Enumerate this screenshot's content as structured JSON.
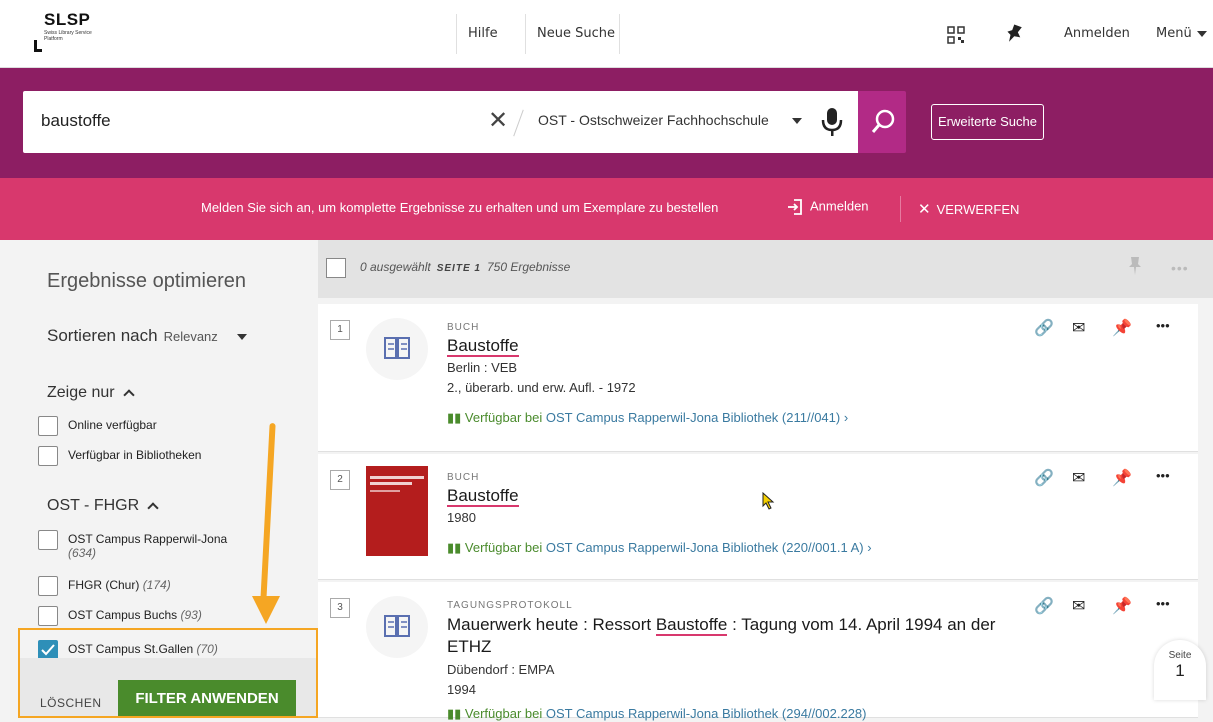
{
  "header": {
    "logo_title": "SLSP",
    "logo_subtitle": "Swiss Library Service Platform",
    "nav": [
      "Hilfe",
      "Neue Suche"
    ],
    "login": "Anmelden",
    "menu": "Menü"
  },
  "search": {
    "query": "baustoffe",
    "scope": "OST - Ostschweizer Fachhochschule",
    "advanced": "Erweiterte Suche"
  },
  "banner": {
    "message": "Melden Sie sich an, um komplette Ergebnisse zu erhalten und um Exemplare zu bestellen",
    "login": "Anmelden",
    "dismiss": "VERWERFEN"
  },
  "sidebar": {
    "title": "Ergebnisse optimieren",
    "sort_label": "Sortieren nach",
    "sort_value": "Relevanz",
    "show_only_title": "Zeige nur",
    "show_only": [
      {
        "label": "Online verfügbar",
        "checked": false
      },
      {
        "label": "Verfügbar in Bibliotheken",
        "checked": false
      }
    ],
    "group_title": "OST - FHGR",
    "locations": [
      {
        "label": "OST Campus Rapperwil-Jona",
        "count": "(634)",
        "checked": false
      },
      {
        "label": "FHGR (Chur)",
        "count": "(174)",
        "checked": false
      },
      {
        "label": "OST Campus Buchs",
        "count": "(93)",
        "checked": false
      },
      {
        "label": "OST Campus St.Gallen",
        "count": "(70)",
        "checked": true
      }
    ],
    "clear_button": "LÖSCHEN",
    "apply_button": "FILTER ANWENDEN"
  },
  "results_header": {
    "selected": "0 ausgewählt",
    "page": "SEITE 1",
    "count": "750 Ergebnisse"
  },
  "results": [
    {
      "number": "1",
      "type": "BUCH",
      "title": "Baustoffe",
      "publisher": "Berlin : VEB",
      "edition": "2., überarb. und erw. Aufl. - 1972",
      "avail_prefix": "Verfügbar bei",
      "avail_location": "OST Campus Rapperwil-Jona  Bibliothek (211//041)"
    },
    {
      "number": "2",
      "type": "BUCH",
      "title": "Baustoffe",
      "year": "1980",
      "avail_prefix": "Verfügbar bei",
      "avail_location": "OST Campus Rapperwil-Jona  Bibliothek (220//001.1 A)"
    },
    {
      "number": "3",
      "type": "TAGUNGSPROTOKOLL",
      "title_before": "Mauerwerk heute : Ressort ",
      "title_match": "Baustoffe",
      "title_after": " : Tagung vom 14. April 1994 an der",
      "title_line2": "ETHZ",
      "publisher": "Dübendorf : EMPA",
      "year": "1994",
      "avail_prefix": "Verfügbar bei",
      "avail_location": "OST Campus Rapperwil-Jona  Bibliothek (294//002.228)"
    }
  ],
  "page_indicator": {
    "label": "Seite",
    "number": "1"
  },
  "colors": {
    "brand": "#8d1e63",
    "banner": "#d8386d",
    "apply": "#4a8b2c",
    "highlight": "#f5a623"
  }
}
